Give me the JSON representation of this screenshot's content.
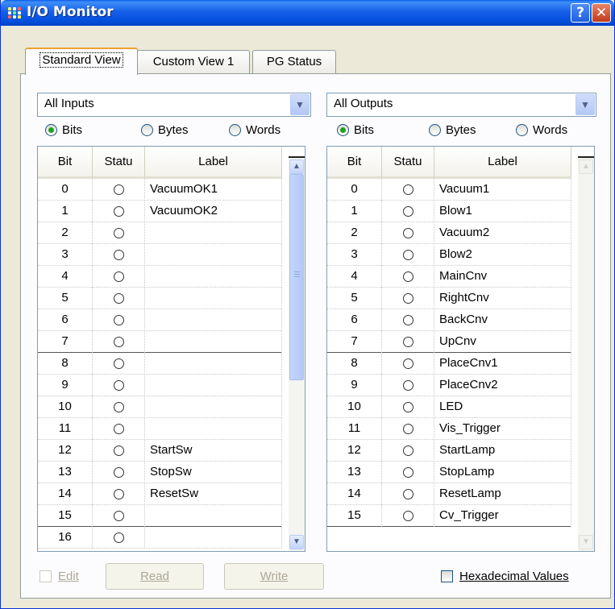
{
  "window": {
    "title": "I/O Monitor",
    "help_glyph": "?",
    "close_glyph": "✕"
  },
  "tabs": [
    {
      "label": "Standard View"
    },
    {
      "label": "Custom View 1"
    },
    {
      "label": "PG Status"
    }
  ],
  "inputs": {
    "dropdown_value": "All Inputs",
    "radios": {
      "bits": "Bits",
      "bytes": "Bytes",
      "words": "Words",
      "selected": "bits"
    },
    "columns": {
      "bit": "Bit",
      "status": "Statu",
      "label": "Label"
    },
    "rows": [
      {
        "bit": "0",
        "label": "VacuumOK1"
      },
      {
        "bit": "1",
        "label": "VacuumOK2"
      },
      {
        "bit": "2",
        "label": ""
      },
      {
        "bit": "3",
        "label": ""
      },
      {
        "bit": "4",
        "label": ""
      },
      {
        "bit": "5",
        "label": ""
      },
      {
        "bit": "6",
        "label": ""
      },
      {
        "bit": "7",
        "label": ""
      },
      {
        "bit": "8",
        "label": ""
      },
      {
        "bit": "9",
        "label": ""
      },
      {
        "bit": "10",
        "label": ""
      },
      {
        "bit": "11",
        "label": ""
      },
      {
        "bit": "12",
        "label": "StartSw"
      },
      {
        "bit": "13",
        "label": "StopSw"
      },
      {
        "bit": "14",
        "label": "ResetSw"
      },
      {
        "bit": "15",
        "label": ""
      },
      {
        "bit": "16",
        "label": ""
      }
    ]
  },
  "outputs": {
    "dropdown_value": "All Outputs",
    "radios": {
      "bits": "Bits",
      "bytes": "Bytes",
      "words": "Words",
      "selected": "bits"
    },
    "columns": {
      "bit": "Bit",
      "status": "Statu",
      "label": "Label"
    },
    "rows": [
      {
        "bit": "0",
        "label": "Vacuum1"
      },
      {
        "bit": "1",
        "label": "Blow1"
      },
      {
        "bit": "2",
        "label": "Vacuum2"
      },
      {
        "bit": "3",
        "label": "Blow2"
      },
      {
        "bit": "4",
        "label": "MainCnv"
      },
      {
        "bit": "5",
        "label": "RightCnv"
      },
      {
        "bit": "6",
        "label": "BackCnv"
      },
      {
        "bit": "7",
        "label": "UpCnv"
      },
      {
        "bit": "8",
        "label": "PlaceCnv1"
      },
      {
        "bit": "9",
        "label": "PlaceCnv2"
      },
      {
        "bit": "10",
        "label": "LED"
      },
      {
        "bit": "11",
        "label": "Vis_Trigger"
      },
      {
        "bit": "12",
        "label": "StartLamp"
      },
      {
        "bit": "13",
        "label": "StopLamp"
      },
      {
        "bit": "14",
        "label": "ResetLamp"
      },
      {
        "bit": "15",
        "label": "Cv_Trigger"
      }
    ]
  },
  "footer": {
    "edit_label": "Edit",
    "read_label": "Read",
    "write_label": "Write",
    "hex_label": "Hexadecimal Values"
  }
}
